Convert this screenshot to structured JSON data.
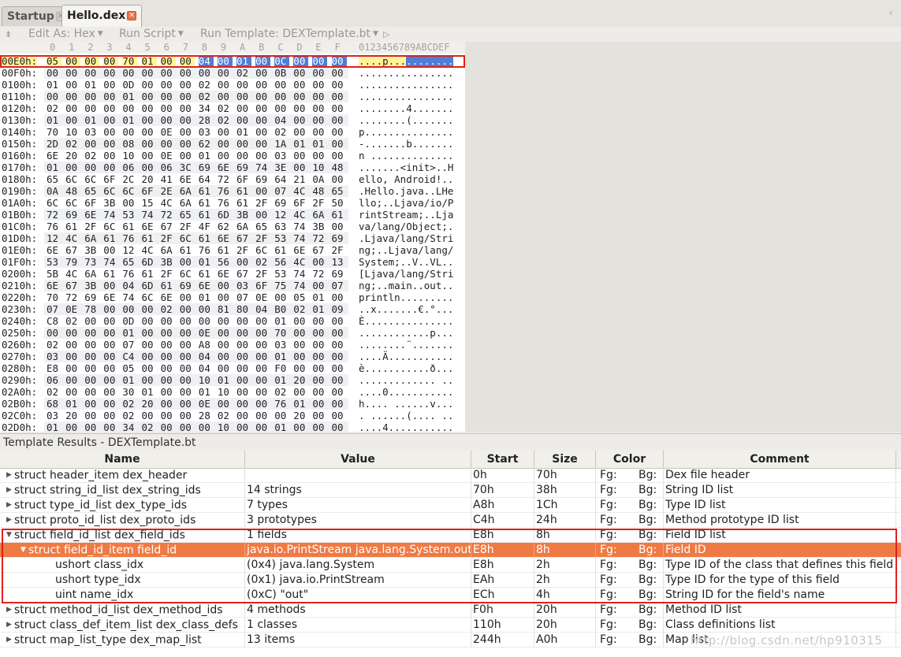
{
  "tabs": [
    {
      "label": "Startup",
      "active": false
    },
    {
      "label": "Hello.dex",
      "active": true
    }
  ],
  "toolbar": {
    "edit_as": "Edit As: Hex",
    "run_script": "Run Script",
    "run_template": "Run Template: DEXTemplate.bt"
  },
  "hex": {
    "columns": [
      "0",
      "1",
      "2",
      "3",
      "4",
      "5",
      "6",
      "7",
      "8",
      "9",
      "A",
      "B",
      "C",
      "D",
      "E",
      "F"
    ],
    "ascii_header": "0123456789ABCDEF",
    "rows": [
      {
        "addr": "00E0h:",
        "bytes": "05 00 00 00 70 01 00 00 04 00 01 00 0C 00 00 00",
        "ascii": "....p..........."
      },
      {
        "addr": "00F0h:",
        "bytes": "00 00 00 00 00 00 00 00 00 00 02 00 0B 00 00 00",
        "ascii": "................"
      },
      {
        "addr": "0100h:",
        "bytes": "01 00 01 00 0D 00 00 00 02 00 00 00 00 00 00 00",
        "ascii": "................"
      },
      {
        "addr": "0110h:",
        "bytes": "00 00 00 00 01 00 00 00 02 00 00 00 00 00 00 00",
        "ascii": "................"
      },
      {
        "addr": "0120h:",
        "bytes": "02 00 00 00 00 00 00 00 34 02 00 00 00 00 00 00",
        "ascii": "........4......."
      },
      {
        "addr": "0130h:",
        "bytes": "01 00 01 00 01 00 00 00 28 02 00 00 04 00 00 00",
        "ascii": "........(......."
      },
      {
        "addr": "0140h:",
        "bytes": "70 10 03 00 00 00 0E 00 03 00 01 00 02 00 00 00",
        "ascii": "p..............."
      },
      {
        "addr": "0150h:",
        "bytes": "2D 02 00 00 08 00 00 00 62 00 00 00 1A 01 01 00",
        "ascii": "-.......b......."
      },
      {
        "addr": "0160h:",
        "bytes": "6E 20 02 00 10 00 0E 00 01 00 00 00 03 00 00 00",
        "ascii": "n .............."
      },
      {
        "addr": "0170h:",
        "bytes": "01 00 00 00 06 00 06 3C 69 6E 69 74 3E 00 10 48",
        "ascii": ".......<init>..H"
      },
      {
        "addr": "0180h:",
        "bytes": "65 6C 6C 6F 2C 20 41 6E 64 72 6F 69 64 21 0A 00",
        "ascii": "ello, Android!.."
      },
      {
        "addr": "0190h:",
        "bytes": "0A 48 65 6C 6C 6F 2E 6A 61 76 61 00 07 4C 48 65",
        "ascii": ".Hello.java..LHe"
      },
      {
        "addr": "01A0h:",
        "bytes": "6C 6C 6F 3B 00 15 4C 6A 61 76 61 2F 69 6F 2F 50",
        "ascii": "llo;..Ljava/io/P"
      },
      {
        "addr": "01B0h:",
        "bytes": "72 69 6E 74 53 74 72 65 61 6D 3B 00 12 4C 6A 61",
        "ascii": "rintStream;..Lja"
      },
      {
        "addr": "01C0h:",
        "bytes": "76 61 2F 6C 61 6E 67 2F 4F 62 6A 65 63 74 3B 00",
        "ascii": "va/lang/Object;."
      },
      {
        "addr": "01D0h:",
        "bytes": "12 4C 6A 61 76 61 2F 6C 61 6E 67 2F 53 74 72 69",
        "ascii": ".Ljava/lang/Stri"
      },
      {
        "addr": "01E0h:",
        "bytes": "6E 67 3B 00 12 4C 6A 61 76 61 2F 6C 61 6E 67 2F",
        "ascii": "ng;..Ljava/lang/"
      },
      {
        "addr": "01F0h:",
        "bytes": "53 79 73 74 65 6D 3B 00 01 56 00 02 56 4C 00 13",
        "ascii": "System;..V..VL.."
      },
      {
        "addr": "0200h:",
        "bytes": "5B 4C 6A 61 76 61 2F 6C 61 6E 67 2F 53 74 72 69",
        "ascii": "[Ljava/lang/Stri"
      },
      {
        "addr": "0210h:",
        "bytes": "6E 67 3B 00 04 6D 61 69 6E 00 03 6F 75 74 00 07",
        "ascii": "ng;..main..out.."
      },
      {
        "addr": "0220h:",
        "bytes": "70 72 69 6E 74 6C 6E 00 01 00 07 0E 00 05 01 00",
        "ascii": "println........."
      },
      {
        "addr": "0230h:",
        "bytes": "07 0E 78 00 00 00 02 00 00 81 80 04 B0 02 01 09",
        "ascii": "..x.......€.°..."
      },
      {
        "addr": "0240h:",
        "bytes": "C8 02 00 00 0D 00 00 00 00 00 00 00 01 00 00 00",
        "ascii": "È..............."
      },
      {
        "addr": "0250h:",
        "bytes": "00 00 00 00 01 00 00 00 0E 00 00 00 70 00 00 00",
        "ascii": "............p..."
      },
      {
        "addr": "0260h:",
        "bytes": "02 00 00 00 07 00 00 00 A8 00 00 00 03 00 00 00",
        "ascii": "........¨......."
      },
      {
        "addr": "0270h:",
        "bytes": "03 00 00 00 C4 00 00 00 04 00 00 00 01 00 00 00",
        "ascii": "....Ä..........."
      },
      {
        "addr": "0280h:",
        "bytes": "E8 00 00 00 05 00 00 00 04 00 00 00 F0 00 00 00",
        "ascii": "è...........ð..."
      },
      {
        "addr": "0290h:",
        "bytes": "06 00 00 00 01 00 00 00 10 01 00 00 01 20 00 00",
        "ascii": "............. .."
      },
      {
        "addr": "02A0h:",
        "bytes": "02 00 00 00 30 01 00 00 01 10 00 00 02 00 00 00",
        "ascii": "....0..........."
      },
      {
        "addr": "02B0h:",
        "bytes": "68 01 00 00 02 20 00 00 0E 00 00 00 76 01 00 00",
        "ascii": "h.... ......v..."
      },
      {
        "addr": "02C0h:",
        "bytes": "03 20 00 00 02 00 00 00 28 02 00 00 00 20 00 00",
        "ascii": ". ......(.... .."
      },
      {
        "addr": "02D0h:",
        "bytes": "01 00 00 00 34 02 00 00 00 10 00 00 01 00 00 00",
        "ascii": "....4..........."
      }
    ]
  },
  "template_results": {
    "title": "Template Results - DEXTemplate.bt",
    "headers": {
      "name": "Name",
      "value": "Value",
      "start": "Start",
      "size": "Size",
      "color": "Color",
      "comment": "Comment"
    },
    "rows": [
      {
        "name": "struct header_item dex_header",
        "value": "",
        "start": "0h",
        "size": "70h",
        "fg": "Fg:",
        "bg": "Bg:",
        "comment": "Dex file header",
        "indent": 0,
        "arrow": "▶"
      },
      {
        "name": "struct string_id_list dex_string_ids",
        "value": "14 strings",
        "start": "70h",
        "size": "38h",
        "fg": "Fg:",
        "bg": "Bg:",
        "comment": "String ID list",
        "indent": 0,
        "arrow": "▶"
      },
      {
        "name": "struct type_id_list dex_type_ids",
        "value": "7 types",
        "start": "A8h",
        "size": "1Ch",
        "fg": "Fg:",
        "bg": "Bg:",
        "comment": "Type ID list",
        "indent": 0,
        "arrow": "▶"
      },
      {
        "name": "struct proto_id_list dex_proto_ids",
        "value": "3 prototypes",
        "start": "C4h",
        "size": "24h",
        "fg": "Fg:",
        "bg": "Bg:",
        "comment": "Method prototype ID list",
        "indent": 0,
        "arrow": "▶"
      },
      {
        "name": "struct field_id_list dex_field_ids",
        "value": "1 fields",
        "start": "E8h",
        "size": "8h",
        "fg": "Fg:",
        "bg": "Bg:",
        "comment": "Field ID list",
        "indent": 0,
        "arrow": "▼"
      },
      {
        "name": "struct field_id_item field_id",
        "value": "java.io.PrintStream java.lang.System.out",
        "start": "E8h",
        "size": "8h",
        "fg": "Fg:",
        "bg": "Bg:",
        "comment": "Field ID",
        "indent": 1,
        "arrow": "▼",
        "selected": true
      },
      {
        "name": "ushort class_idx",
        "value": "(0x4) java.lang.System",
        "start": "E8h",
        "size": "2h",
        "fg": "Fg:",
        "bg": "Bg:",
        "comment": "Type ID of the class that defines this field",
        "indent": 2,
        "arrow": ""
      },
      {
        "name": "ushort type_idx",
        "value": "(0x1) java.io.PrintStream",
        "start": "EAh",
        "size": "2h",
        "fg": "Fg:",
        "bg": "Bg:",
        "comment": "Type ID for the type of this field",
        "indent": 2,
        "arrow": ""
      },
      {
        "name": "uint name_idx",
        "value": "(0xC) \"out\"",
        "start": "ECh",
        "size": "4h",
        "fg": "Fg:",
        "bg": "Bg:",
        "comment": "String ID for the field's name",
        "indent": 2,
        "arrow": ""
      },
      {
        "name": "struct method_id_list dex_method_ids",
        "value": "4 methods",
        "start": "F0h",
        "size": "20h",
        "fg": "Fg:",
        "bg": "Bg:",
        "comment": "Method ID list",
        "indent": 0,
        "arrow": "▶"
      },
      {
        "name": "struct class_def_item_list dex_class_defs",
        "value": "1 classes",
        "start": "110h",
        "size": "20h",
        "fg": "Fg:",
        "bg": "Bg:",
        "comment": "Class definitions list",
        "indent": 0,
        "arrow": "▶"
      },
      {
        "name": "struct map_list_type dex_map_list",
        "value": "13 items",
        "start": "244h",
        "size": "A0h",
        "fg": "Fg:",
        "bg": "Bg:",
        "comment": "Map list",
        "indent": 0,
        "arrow": "▶"
      }
    ]
  },
  "watermark": "http://blog.csdn.net/hp910315"
}
